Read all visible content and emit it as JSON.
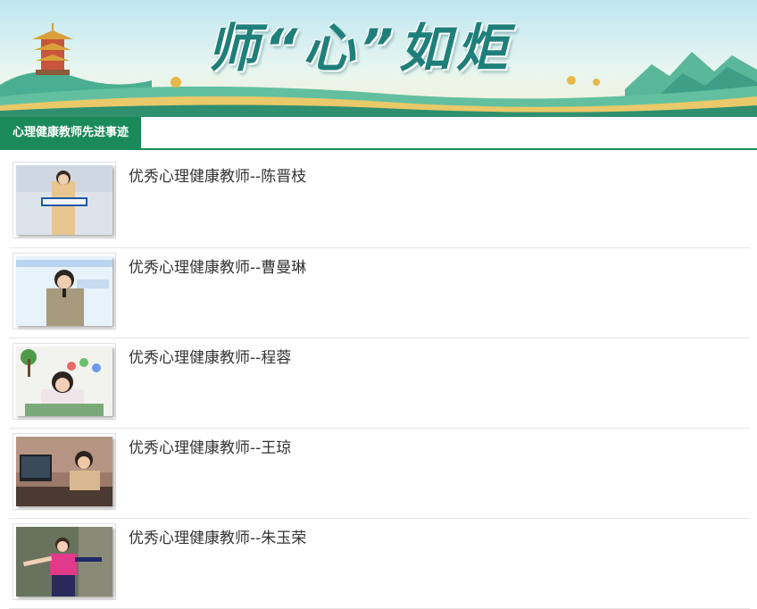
{
  "banner": {
    "title": "师“心”如炬",
    "colors": {
      "sky": "#cfeaf2",
      "hills": "#3aa58c",
      "ground": "#e9c96a",
      "title": "#1f7f7a"
    },
    "tower_icon": "pagoda-tower-icon",
    "mountain_icon": "mountains-icon"
  },
  "tabs": [
    {
      "label": "心理健康教师先进事迹",
      "active": true
    }
  ],
  "accent_color": "#1b8a5a",
  "articles": [
    {
      "title": "优秀心理健康教师--陈晋枝",
      "thumbnail": "teacher-holding-sign-photo"
    },
    {
      "title": "优秀心理健康教师--曹曼琳",
      "thumbnail": "teacher-speaking-microphone-photo"
    },
    {
      "title": "优秀心理健康教师--程蓉",
      "thumbnail": "teacher-at-desk-photo"
    },
    {
      "title": "优秀心理健康教师--王琼",
      "thumbnail": "teacher-at-computer-photo"
    },
    {
      "title": "优秀心理健康教师--朱玉荣",
      "thumbnail": "teacher-dancing-outdoors-photo"
    }
  ]
}
